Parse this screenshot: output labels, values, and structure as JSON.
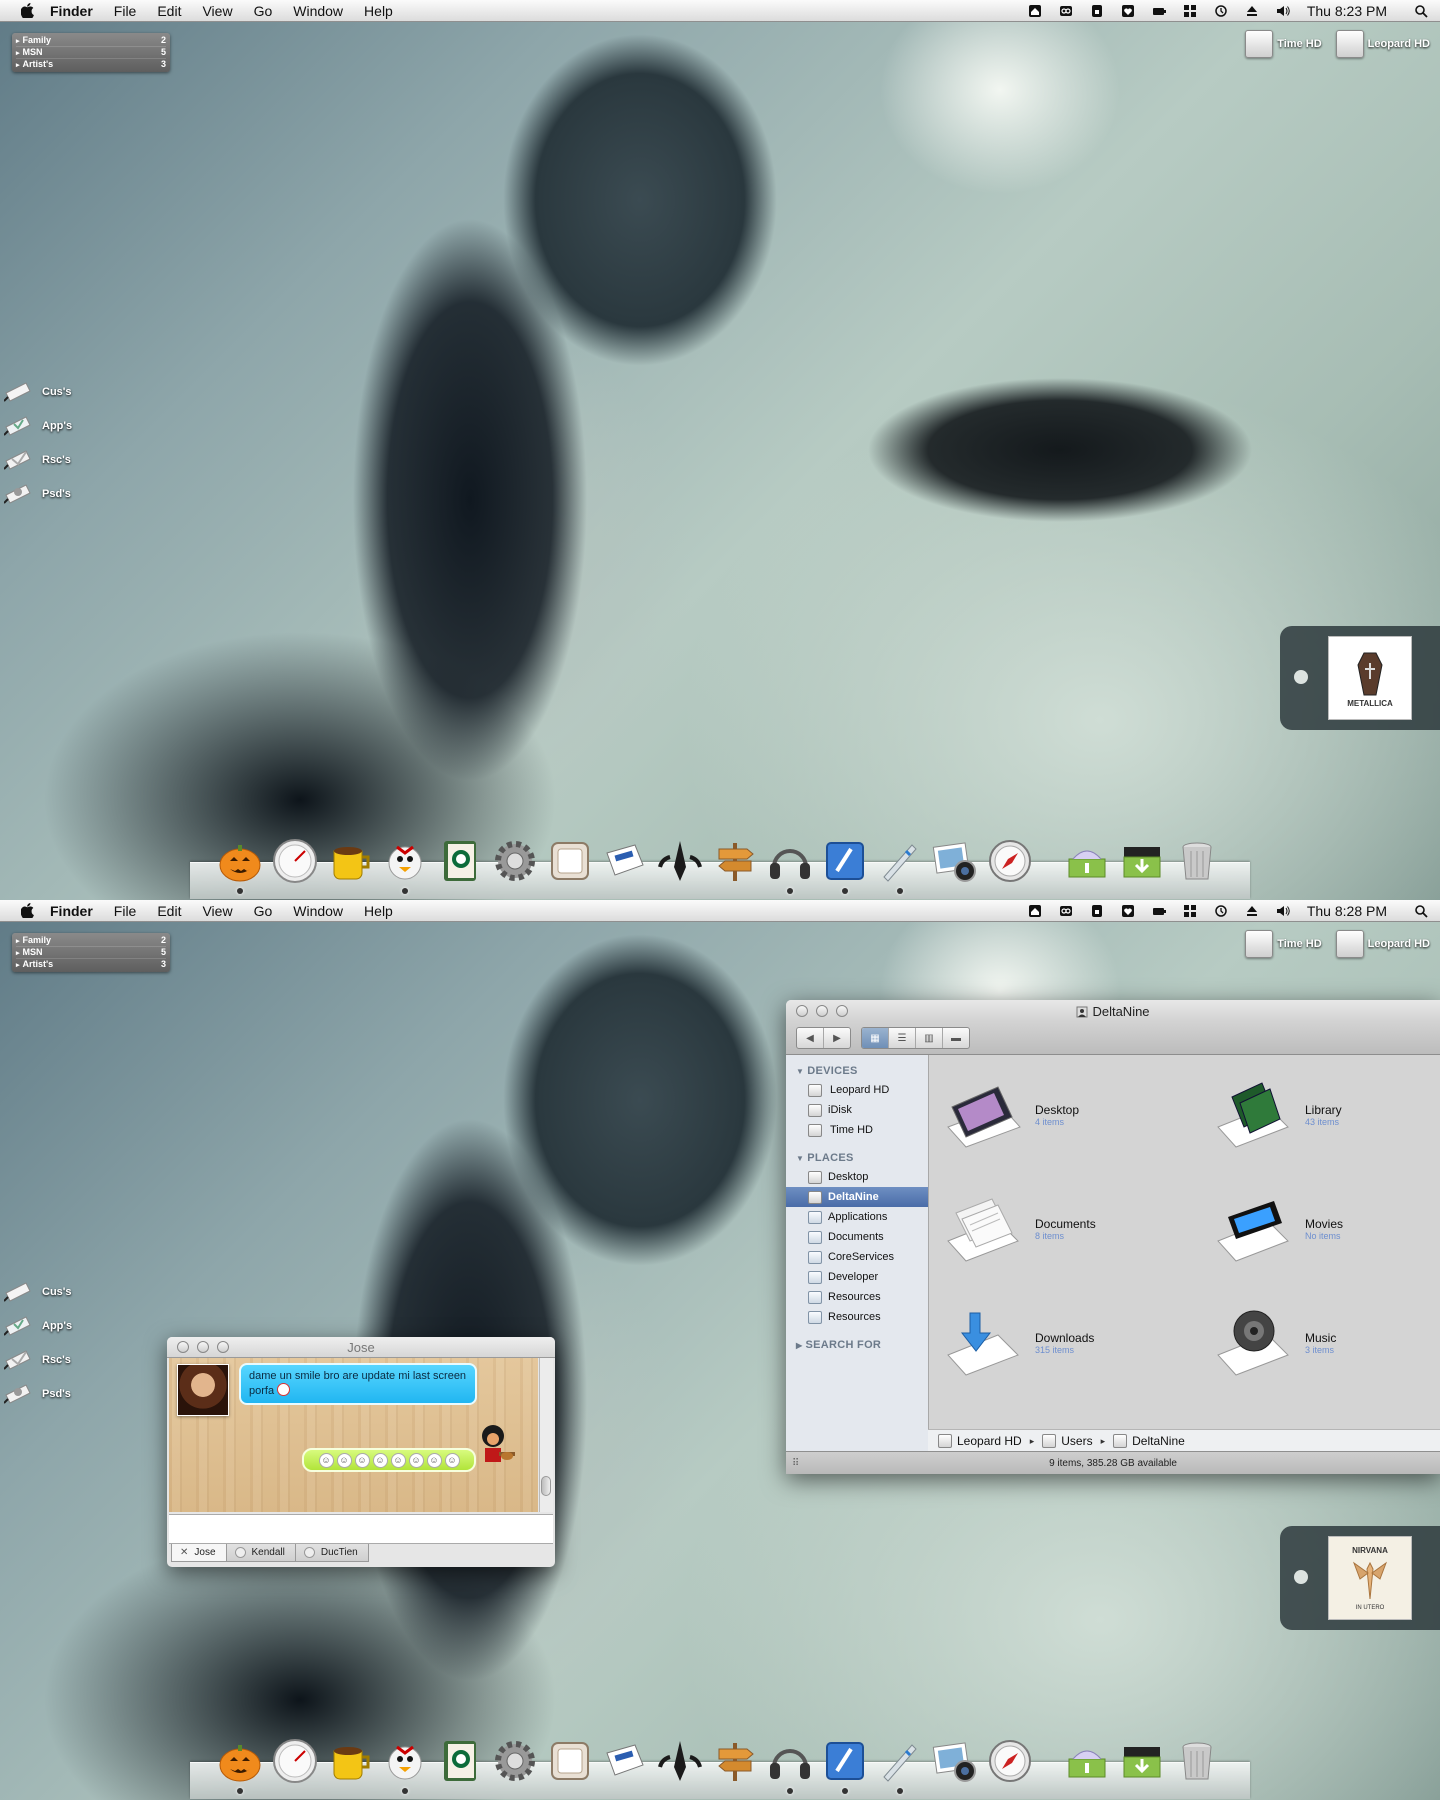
{
  "menubar": {
    "app_name": "Finder",
    "items": [
      "File",
      "Edit",
      "View",
      "Go",
      "Window",
      "Help"
    ],
    "status_icons": [
      "home-icon",
      "infinity-icon",
      "lock-icon",
      "heart-icon",
      "battery-icon",
      "spaces-icon",
      "time-machine-icon",
      "eject-icon",
      "volume-icon"
    ],
    "spotlight_icon": "spotlight-search-icon"
  },
  "screen1": {
    "clock": "Thu 8:23 PM"
  },
  "screen2": {
    "clock": "Thu 8:28 PM"
  },
  "stacks_widget": {
    "rows": [
      {
        "label": "Family",
        "count": "2"
      },
      {
        "label": "MSN",
        "count": "5"
      },
      {
        "label": "Artist's",
        "count": "3"
      }
    ]
  },
  "drives": [
    {
      "label": "Time HD",
      "icon": "hard-drive-icon"
    },
    {
      "label": "Leopard HD",
      "icon": "hard-drive-icon"
    }
  ],
  "shortcuts": [
    {
      "label": "Cus's",
      "icon": "shortcut-folder-icon"
    },
    {
      "label": "App's",
      "icon": "shortcut-apps-icon"
    },
    {
      "label": "Rsc's",
      "icon": "shortcut-resources-icon"
    },
    {
      "label": "Psd's",
      "icon": "shortcut-psd-icon"
    }
  ],
  "album_art": {
    "screen1": {
      "icon": "album-cover-icon",
      "text": "METALLICA"
    },
    "screen2": {
      "icon": "album-cover-icon",
      "text": "NIRVANA",
      "subtext": "IN UTERO"
    }
  },
  "dock": {
    "apps": [
      "pumpkin-icon",
      "gauge-icon",
      "coffee-mug-icon",
      "adium-duck-icon",
      "address-book-icon",
      "system-preferences-icon",
      "calendar-icon",
      "newspaper-icon",
      "penguin-icon",
      "signpost-icon",
      "headphones-icon",
      "app-store-icon",
      "pencil-icon",
      "iphoto-icon",
      "safari-compass-icon"
    ],
    "stacks": [
      "drop-box-stack-icon",
      "downloads-stack-icon",
      "trash-icon"
    ]
  },
  "finder": {
    "title": "DeltaNine",
    "view_buttons": [
      "icon-view",
      "list-view",
      "column-view",
      "coverflow-view"
    ],
    "sidebar": {
      "devices_header": "DEVICES",
      "devices": [
        "Leopard HD",
        "iDisk",
        "Time HD"
      ],
      "places_header": "PLACES",
      "places": [
        "Desktop",
        "DeltaNine",
        "Applications",
        "Documents",
        "CoreServices",
        "Developer",
        "Resources",
        "Resources"
      ],
      "search_header": "SEARCH FOR"
    },
    "items": [
      {
        "name": "Desktop",
        "sub": "4 items",
        "icon": "desktop-folder-icon"
      },
      {
        "name": "Library",
        "sub": "43 items",
        "icon": "library-books-icon"
      },
      {
        "name": "Documents",
        "sub": "8 items",
        "icon": "documents-icon"
      },
      {
        "name": "Movies",
        "sub": "No items",
        "icon": "movies-icon"
      },
      {
        "name": "Downloads",
        "sub": "315 items",
        "icon": "downloads-icon"
      },
      {
        "name": "Music",
        "sub": "3 items",
        "icon": "music-speaker-icon"
      }
    ],
    "path": [
      "Leopard HD",
      "Users",
      "DeltaNine"
    ],
    "status": "9 items, 385.28 GB available"
  },
  "chat": {
    "title": "Jose",
    "message_in": "dame un smile bro are update mi last screen porfa",
    "smileys_count": 8,
    "tabs": [
      {
        "label": "Jose",
        "active": true
      },
      {
        "label": "Kendall",
        "active": false
      },
      {
        "label": "DucTien",
        "active": false
      }
    ]
  },
  "colors": {
    "selection": "#4a6ca8",
    "bubble_blue": "#21b6f1",
    "bubble_green": "#b1e43a",
    "sub_text": "#6e8fcf"
  }
}
